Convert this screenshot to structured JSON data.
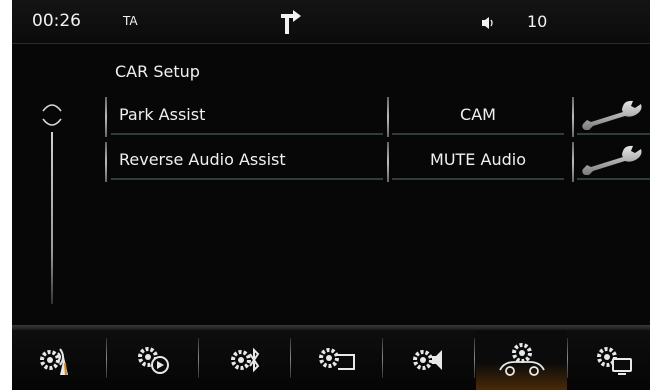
{
  "status": {
    "time": "00:26",
    "ta": "TA",
    "navigation_icon": "turn-right-arrow-icon",
    "volume_icon": "speaker-icon",
    "volume": "10"
  },
  "page": {
    "title": "CAR Setup"
  },
  "settings": [
    {
      "label": "Park Assist",
      "value": "CAM",
      "action_icon": "wrench-icon"
    },
    {
      "label": "Reverse Audio Assist",
      "value": "MUTE Audio",
      "action_icon": "wrench-icon"
    }
  ],
  "tabs": [
    {
      "name": "gear-antenna-icon",
      "active": false
    },
    {
      "name": "gear-play-icon",
      "active": false
    },
    {
      "name": "gear-bluetooth-icon",
      "active": false
    },
    {
      "name": "gear-display-icon",
      "active": false
    },
    {
      "name": "gear-speaker-icon",
      "active": false
    },
    {
      "name": "gear-car-icon",
      "active": true
    },
    {
      "name": "gear-screen-icon",
      "active": false
    }
  ],
  "colors": {
    "background": "#070707",
    "text": "#f0f0f0",
    "active_tab_glow": "#4a2a08"
  }
}
